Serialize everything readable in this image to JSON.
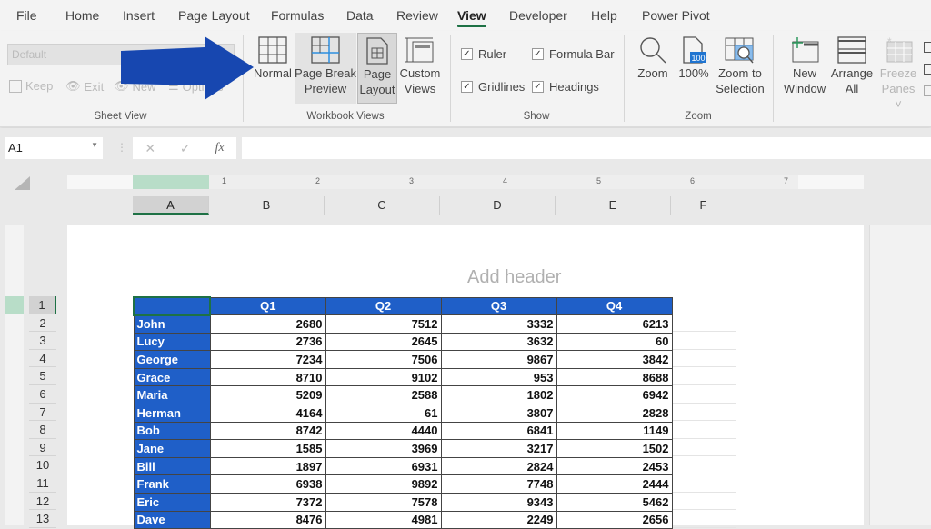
{
  "tabs": [
    {
      "label": "File"
    },
    {
      "label": "Home"
    },
    {
      "label": "Insert"
    },
    {
      "label": "Page Layout"
    },
    {
      "label": "Formulas"
    },
    {
      "label": "Data"
    },
    {
      "label": "Review"
    },
    {
      "label": "View",
      "active": true
    },
    {
      "label": "Developer"
    },
    {
      "label": "Help"
    },
    {
      "label": "Power Pivot"
    }
  ],
  "ribbon": {
    "sheet_view": {
      "dropdown_value": "Default",
      "keep": "Keep",
      "exit": "Exit",
      "new": "New",
      "options": "Options",
      "label": "Sheet View"
    },
    "workbook_views": {
      "normal": "Normal",
      "page_break_1": "Page Break",
      "page_break_2": "Preview",
      "page_layout_1": "Page",
      "page_layout_2": "Layout",
      "custom_1": "Custom",
      "custom_2": "Views",
      "label": "Workbook Views"
    },
    "show": {
      "ruler": "Ruler",
      "formula_bar": "Formula Bar",
      "gridlines": "Gridlines",
      "headings": "Headings",
      "ruler_checked": true,
      "formula_bar_checked": true,
      "gridlines_checked": true,
      "headings_checked": true,
      "label": "Show"
    },
    "zoom": {
      "zoom": "Zoom",
      "hundred": "100%",
      "hundred_icon_text": "100",
      "zoom_sel_1": "Zoom to",
      "zoom_sel_2": "Selection",
      "label": "Zoom"
    },
    "window": {
      "new_1": "New",
      "new_2": "Window",
      "arrange_1": "Arrange",
      "arrange_2": "All",
      "freeze_1": "Freeze",
      "freeze_2": "Panes ˅"
    }
  },
  "formula_bar": {
    "name_box": "A1",
    "cancel": "✕",
    "enter": "✓",
    "fx": "fx",
    "value": ""
  },
  "ruler_ticks": [
    "1",
    "2",
    "3",
    "4",
    "5",
    "6",
    "7"
  ],
  "sheet": {
    "add_header": "Add header",
    "columns": [
      "A",
      "B",
      "C",
      "D",
      "E",
      "F"
    ],
    "rows": [
      "1",
      "2",
      "3",
      "4",
      "5",
      "6",
      "7",
      "8",
      "9",
      "10",
      "11",
      "12",
      "13"
    ],
    "headers": [
      "",
      "Q1",
      "Q2",
      "Q3",
      "Q4"
    ],
    "data": [
      [
        "John",
        "2680",
        "7512",
        "3332",
        "6213"
      ],
      [
        "Lucy",
        "2736",
        "2645",
        "3632",
        "60"
      ],
      [
        "George",
        "7234",
        "7506",
        "9867",
        "3842"
      ],
      [
        "Grace",
        "8710",
        "9102",
        "953",
        "8688"
      ],
      [
        "Maria",
        "5209",
        "2588",
        "1802",
        "6942"
      ],
      [
        "Herman",
        "4164",
        "61",
        "3807",
        "2828"
      ],
      [
        "Bob",
        "8742",
        "4440",
        "6841",
        "1149"
      ],
      [
        "Jane",
        "1585",
        "3969",
        "3217",
        "1502"
      ],
      [
        "Bill",
        "1897",
        "6931",
        "2824",
        "2453"
      ],
      [
        "Frank",
        "6938",
        "9892",
        "7748",
        "2444"
      ],
      [
        "Eric",
        "7372",
        "7578",
        "9343",
        "5462"
      ],
      [
        "Dave",
        "8476",
        "4981",
        "2249",
        "2656"
      ]
    ]
  },
  "colors": {
    "accent_green": "#1e7145",
    "table_blue": "#1f5fc8",
    "arrow_blue": "#1747b0"
  }
}
